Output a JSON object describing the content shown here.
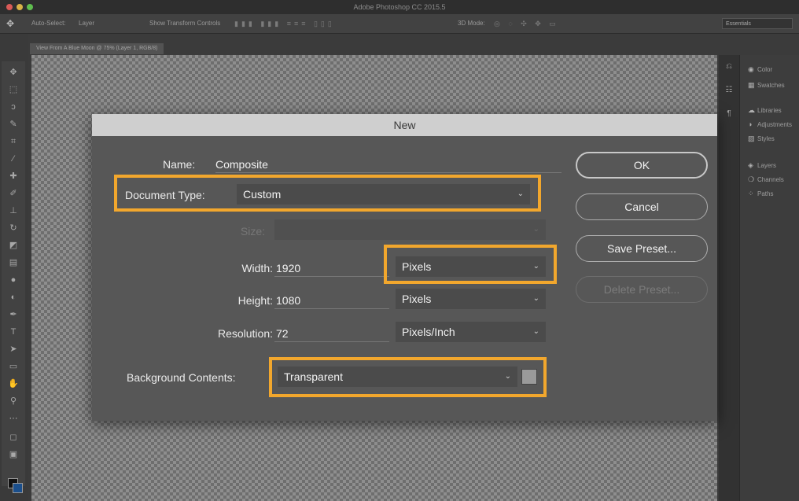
{
  "app": {
    "title": "Adobe Photoshop CC 2015.5"
  },
  "options_bar": {
    "auto_select_label": "Auto-Select:",
    "auto_select_value": "Layer",
    "transform_controls_label": "Show Transform Controls",
    "mode_label": "3D Mode:",
    "workspace": "Essentials"
  },
  "document_tab": {
    "label": "View From A Blue Moon @ 75% (Layer 1, RGB/8)"
  },
  "right_panel": {
    "items": [
      {
        "label": "Color",
        "icon": "color-wheel-icon"
      },
      {
        "label": "Swatches",
        "icon": "grid-icon"
      },
      {
        "label": "Libraries",
        "icon": "cloud-library-icon"
      },
      {
        "label": "Adjustments",
        "icon": "adjustments-icon"
      },
      {
        "label": "Styles",
        "icon": "styles-icon"
      },
      {
        "label": "Layers",
        "icon": "layers-icon"
      },
      {
        "label": "Channels",
        "icon": "channels-icon"
      },
      {
        "label": "Paths",
        "icon": "paths-icon"
      }
    ]
  },
  "dialog": {
    "title": "New",
    "name_label": "Name:",
    "name_value": "Composite",
    "document_type_label": "Document Type:",
    "document_type_value": "Custom",
    "size_label": "Size:",
    "width_label": "Width:",
    "width_value": "1920",
    "width_unit": "Pixels",
    "height_label": "Height:",
    "height_value": "1080",
    "height_unit": "Pixels",
    "resolution_label": "Resolution:",
    "resolution_value": "72",
    "resolution_unit": "Pixels/Inch",
    "background_label": "Background Contents:",
    "background_value": "Transparent",
    "buttons": {
      "ok": "OK",
      "cancel": "Cancel",
      "save_preset": "Save Preset...",
      "delete_preset": "Delete Preset..."
    }
  },
  "colors": {
    "highlight": "#f2a72d",
    "dialog_bg": "#575757",
    "title_bar": "#cfcfcf"
  }
}
